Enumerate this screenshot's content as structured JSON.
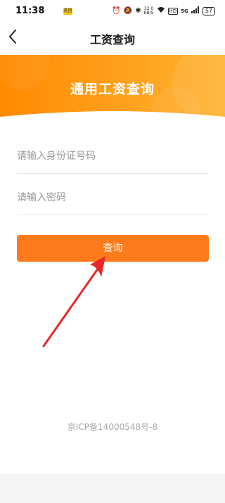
{
  "status_bar": {
    "time": "11:38",
    "app_badge": "美团",
    "net_speed_value": "32.0",
    "net_speed_unit": "KB/S",
    "hd_label": "HD",
    "signal_label": "5G",
    "battery": "57"
  },
  "nav": {
    "title": "工资查询",
    "back_icon": "chevron-left-icon"
  },
  "banner": {
    "title": "通用工资查询",
    "colors": {
      "start": "#ff8a00",
      "end": "#ffb333"
    }
  },
  "form": {
    "id_placeholder": "请输入身份证号码",
    "id_value": "",
    "password_placeholder": "请输入密码",
    "password_value": "",
    "query_label": "查询"
  },
  "footer": {
    "icp": "京ICP备14000548号-8"
  },
  "annotation": {
    "icon": "red-arrow-icon",
    "color": "#e8262a"
  },
  "colors": {
    "accent": "#ff7a1a"
  }
}
